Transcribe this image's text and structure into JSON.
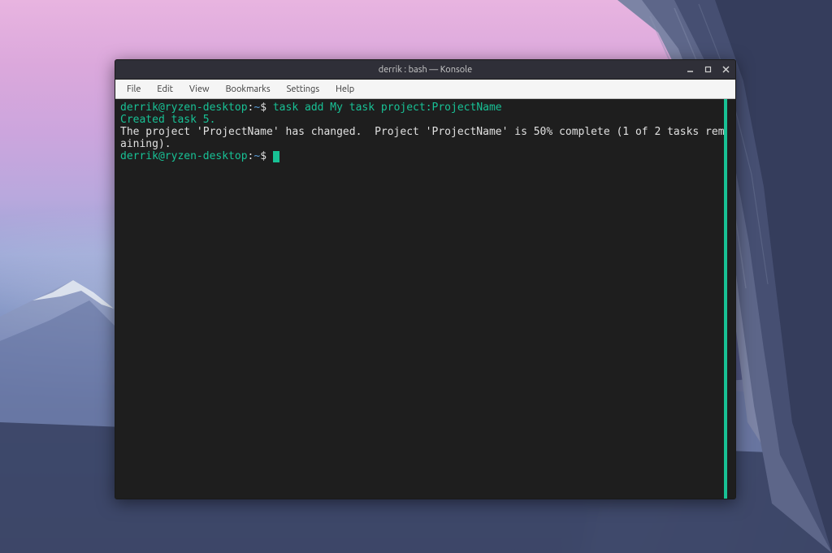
{
  "window": {
    "title": "derrik : bash — Konsole"
  },
  "menubar": {
    "items": [
      "File",
      "Edit",
      "View",
      "Bookmarks",
      "Settings",
      "Help"
    ]
  },
  "terminal": {
    "prompt": {
      "user_host": "derrik@ryzen-desktop",
      "separator": ":",
      "path": "~",
      "symbol": "$"
    },
    "entries": [
      {
        "command": "task add My task project:ProjectName",
        "output_green": "Created task 5.",
        "output_white": "The project 'ProjectName' has changed.  Project 'ProjectName' is 50% complete (1 of 2 tasks remaining)."
      }
    ]
  }
}
